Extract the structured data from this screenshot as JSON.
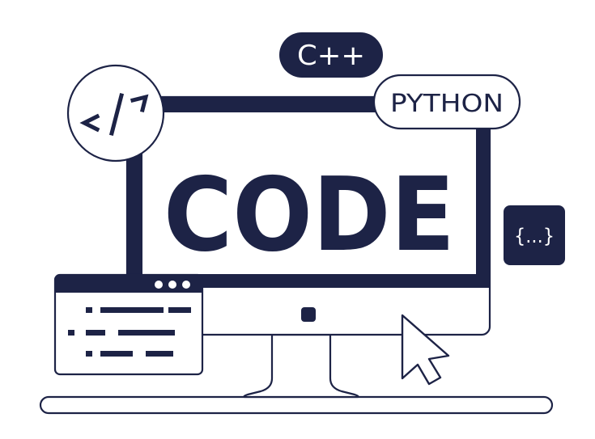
{
  "monitor": {
    "screen_text": "CODE"
  },
  "badges": {
    "cpp": "C++",
    "python": "PYTHON",
    "tag": "</>",
    "braces": "{...}"
  },
  "colors": {
    "navy": "#1d2346",
    "background": "#ffffff"
  },
  "icons": [
    "code-tag-icon",
    "braces-icon",
    "cursor-arrow-icon",
    "window-dots-icon"
  ]
}
